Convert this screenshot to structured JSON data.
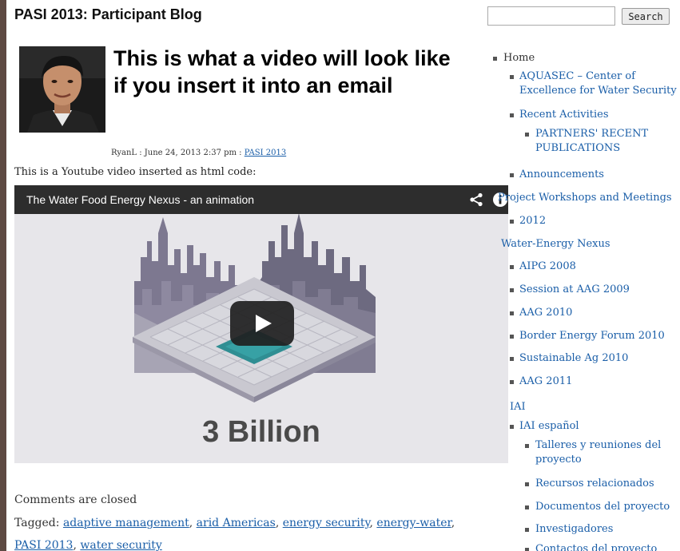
{
  "blog": {
    "title": "PASI 2013: Participant Blog"
  },
  "post": {
    "title": "This is what a video will look like if you insert it into an email",
    "author": "RyanL",
    "date_sep1": " : ",
    "date": "June 24, 2013 2:37 pm",
    "date_sep2": " : ",
    "category": "PASI 2013",
    "intro": "This is a Youtube video inserted as html code:"
  },
  "video": {
    "title": "The Water Food Energy Nexus - an animation",
    "caption": "3 Billion"
  },
  "footer": {
    "comments": "Comments are closed",
    "tagged_label": "Tagged: ",
    "tags": [
      "adaptive management",
      "arid Americas",
      "energy security",
      "energy-water",
      "PASI 2013",
      "water security"
    ]
  },
  "search": {
    "placeholder": "",
    "button": "Search"
  },
  "sidebar": {
    "items": [
      "Home",
      "AQUASEC – Center of",
      "Excellence for Water Security",
      "Recent Activities",
      "PARTNERS' RECENT",
      "PUBLICATIONS",
      "Announcements",
      "Project Workshops and Meetings",
      "2012",
      "Water-Energy Nexus",
      "AIPG 2008",
      "Session at AAG 2009",
      "AAG 2010",
      "Border Energy Forum 2010",
      "Sustainable Ag 2010",
      "AAG 2011",
      "IAI",
      "IAI español",
      "Talleres y reuniones del",
      "proyecto",
      "Recursos relacionados",
      "Documentos del proyecto",
      "Investigadores",
      "Contactos del proyecto"
    ]
  }
}
